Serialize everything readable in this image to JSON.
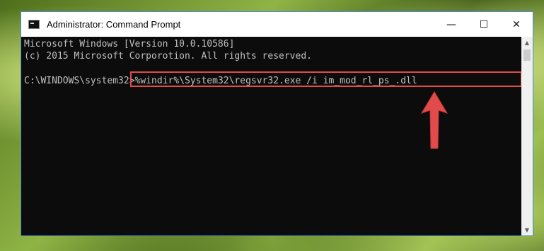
{
  "window": {
    "title": "Administrator: Command Prompt",
    "controls": {
      "minimize": "—",
      "maximize": "☐",
      "close": "✕"
    }
  },
  "console": {
    "lines": [
      "Microsoft Windows [Version 10.0.10586]",
      "(c) 2015 Microsoft Corporotion. All rights reserved."
    ],
    "prompt": "C:\\WINDOWS\\system32>",
    "command": "%windir%\\System32\\regsvr32.exe /i im_mod_rl_ps_.dll"
  },
  "scrollbar": {
    "up": "▲",
    "down": "▼"
  },
  "colors": {
    "highlight": "#e24b4b",
    "arrow": "#e24b4b",
    "console_bg": "#0c0c0c",
    "console_text": "#c0c0c0"
  },
  "icons": {
    "app": "cmd-icon",
    "annotation": "up-arrow-icon"
  }
}
